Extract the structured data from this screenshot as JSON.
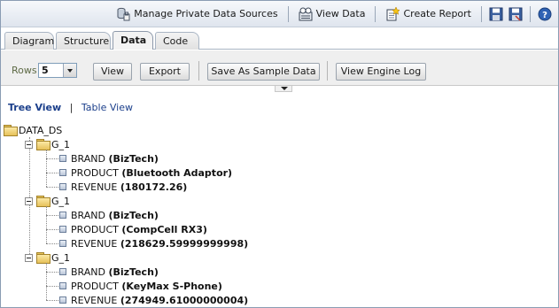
{
  "toolbar": {
    "manage_label": "Manage Private Data Sources",
    "view_data_label": "View Data",
    "create_report_label": "Create Report"
  },
  "tabs": [
    {
      "label": "Diagram"
    },
    {
      "label": "Structure"
    },
    {
      "label": "Data"
    },
    {
      "label": "Code"
    }
  ],
  "options": {
    "rows_label": "Rows",
    "rows_value": "5",
    "view_label": "View",
    "export_label": "Export",
    "save_sample_label": "Save As Sample Data",
    "engine_log_label": "View Engine Log"
  },
  "views": {
    "tree_label": "Tree View",
    "separator": "|",
    "table_label": "Table View"
  },
  "tree": {
    "root": "DATA_DS",
    "groups": [
      {
        "label": "G_1",
        "fields": [
          {
            "name": "BRAND",
            "value": "(BizTech)"
          },
          {
            "name": "PRODUCT",
            "value": "(Bluetooth Adaptor)"
          },
          {
            "name": "REVENUE",
            "value": "(180172.26)"
          }
        ]
      },
      {
        "label": "G_1",
        "fields": [
          {
            "name": "BRAND",
            "value": "(BizTech)"
          },
          {
            "name": "PRODUCT",
            "value": "(CompCell RX3)"
          },
          {
            "name": "REVENUE",
            "value": "(218629.59999999998)"
          }
        ]
      },
      {
        "label": "G_1",
        "fields": [
          {
            "name": "BRAND",
            "value": "(BizTech)"
          },
          {
            "name": "PRODUCT",
            "value": "(KeyMax S-Phone)"
          },
          {
            "name": "REVENUE",
            "value": "(274949.61000000004)"
          }
        ]
      }
    ]
  }
}
